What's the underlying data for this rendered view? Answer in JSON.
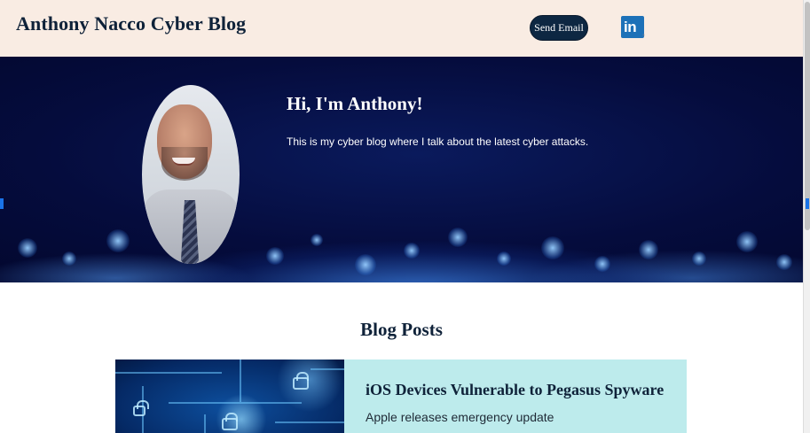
{
  "header": {
    "site_title": "Anthony Nacco Cyber Blog",
    "send_email_label": "Send Email",
    "linkedin_text": "in",
    "linkedin_mark": "®",
    "linkedin_icon": "linkedin-icon"
  },
  "hero": {
    "greeting": "Hi, I'm Anthony!",
    "intro": "This is my cyber blog where I talk about the latest cyber attacks.",
    "photo_icon": "profile-photo"
  },
  "blog": {
    "heading": "Blog Posts",
    "posts": [
      {
        "title": "iOS Devices Vulnerable to Pegasus Spyware",
        "subtitle": "Apple releases emergency update",
        "image_icon": "circuit-lock-image"
      }
    ]
  },
  "colors": {
    "header_bg": "#f9ece3",
    "navy": "#0f2239",
    "button_bg": "#0d2742",
    "linkedin_blue": "#1d71b8",
    "card_bg": "#bdebec",
    "hero_bg": "#050c3d"
  }
}
